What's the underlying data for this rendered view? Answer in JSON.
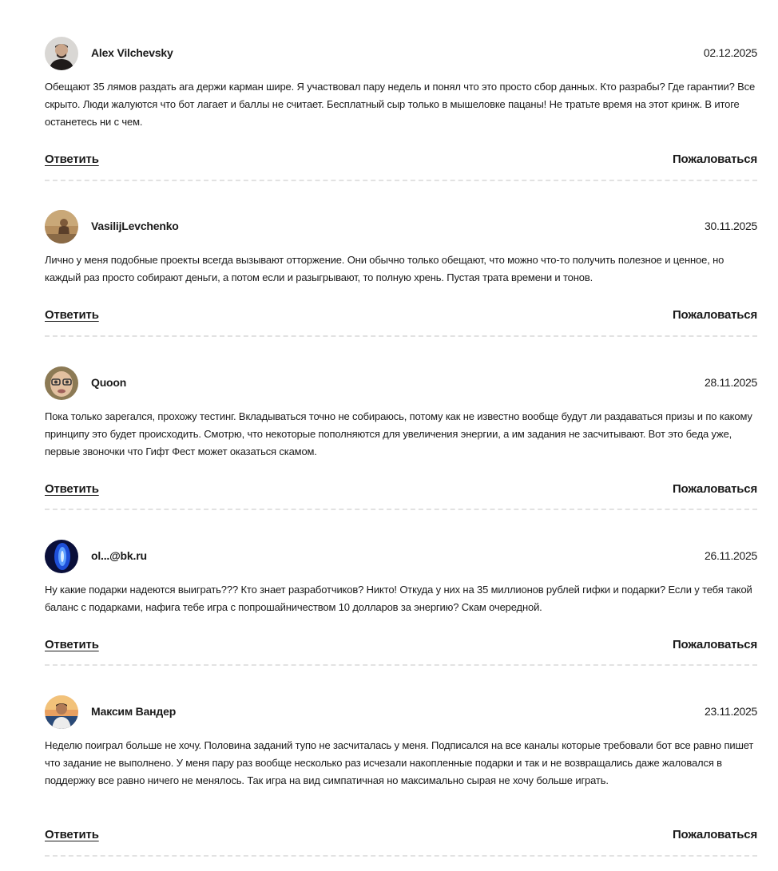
{
  "comments": [
    {
      "author": "Alex Vilchevsky",
      "date": "02.12.2025",
      "text": "Обещают 35 лямов раздать ага держи карман шире. Я участвовал пару недель и понял что это просто сбор данных. Кто разрабы? Где гарантии? Все скрыто. Люди жалуются что бот лагает и баллы не считает. Бесплатный сыр только в мышеловке пацаны! Не тратьте время на этот кринж. В итоге останетесь ни с чем.",
      "reply_label": "Ответить",
      "report_label": "Пожаловаться"
    },
    {
      "author": "VasilijLevchenko",
      "date": "30.11.2025",
      "text": "Лично у меня подобные проекты всегда вызывают отторжение. Они обычно только обещают, что можно что-то получить полезное и ценное, но каждый раз просто собирают деньги, а потом если и разыгрывают, то полную хрень. Пустая трата времени и тонов.",
      "reply_label": "Ответить",
      "report_label": "Пожаловаться"
    },
    {
      "author": "Quoon",
      "date": "28.11.2025",
      "text": "Пока только зарегался, прохожу тестинг. Вкладываться точно не собираюсь, потому как не известно вообще будут ли раздаваться призы и по какому принципу это будет происходить. Смотрю, что некоторые пополняются для увеличения энергии, а им задания не засчитывают. Вот это беда уже, первые звоночки что Гифт Фест может оказаться скамом.",
      "reply_label": "Ответить",
      "report_label": "Пожаловаться"
    },
    {
      "author": "ol...@bk.ru",
      "date": "26.11.2025",
      "text": "Ну какие подарки надеются выиграть??? Кто знает разработчиков? Никто! Откуда у них на 35 миллионов рублей гифки и подарки? Если у тебя такой баланс с подарками, нафига тебе игра с попрошайничеством 10 долларов за энергию? Скам очередной.",
      "reply_label": "Ответить",
      "report_label": "Пожаловаться"
    },
    {
      "author": "Максим Вандер",
      "date": "23.11.2025",
      "text": "Неделю поиграл больше не хочу. Половина заданий тупо не засчиталась у меня. Подписался на все каналы которые требовали бот все равно пишет что задание не выполнено. У меня пару раз вообще несколько раз исчезали накопленные подарки и так и не возвращались даже жаловался в поддержку все равно ничего не менялось. Так игра на вид симпатичная но максимально сырая не хочу больше играть.",
      "reply_label": "Ответить",
      "report_label": "Пожаловаться"
    }
  ]
}
